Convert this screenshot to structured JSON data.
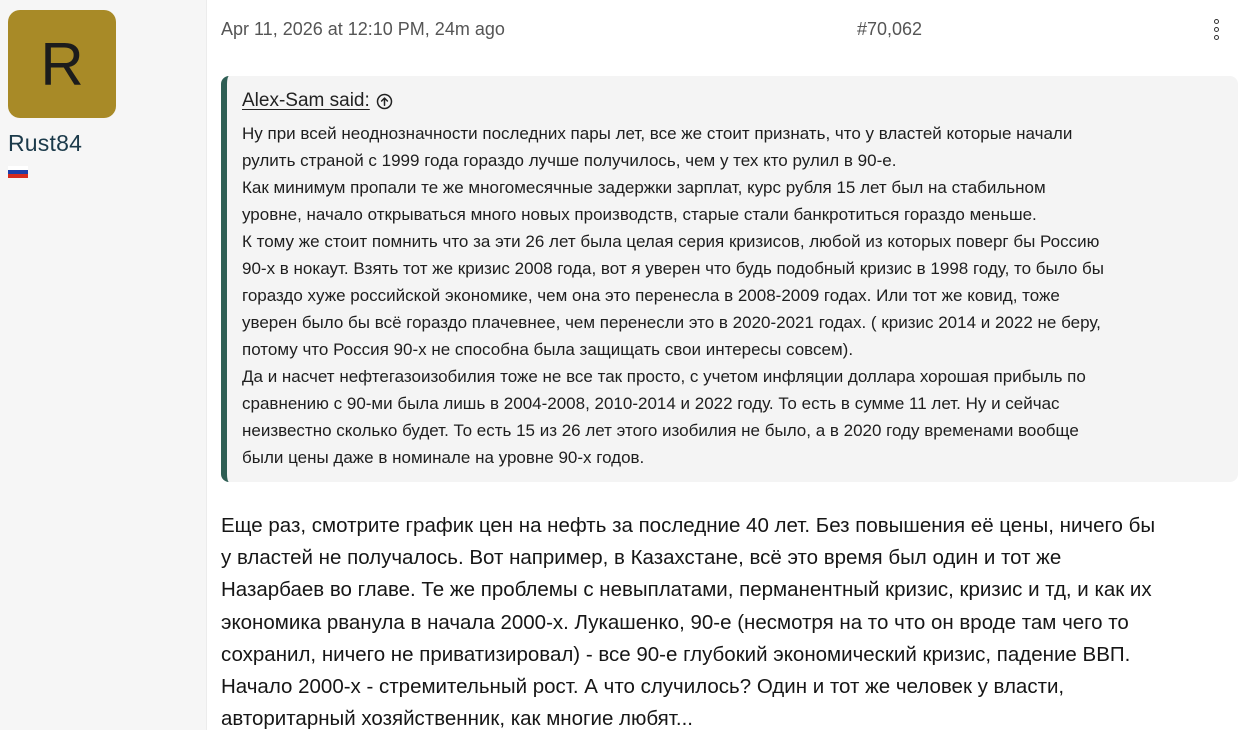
{
  "user": {
    "avatar_letter": "R",
    "avatar_color": "#a88a27",
    "name": "Rust84",
    "flag_icon": "russia-flag-icon",
    "flag_colors": [
      "#ffffff",
      "#1c3fa8",
      "#d52b1e"
    ]
  },
  "post": {
    "date": "Apr 11, 2026 at 12:10 PM, 24m ago",
    "number": "#70,062",
    "menu_icon": "vertical-ellipsis-icon"
  },
  "quote": {
    "author_said": "Alex-Sam said:",
    "jump_icon": "arrow-up-circle-icon",
    "accent_color": "#2e5e54",
    "lines": [
      "Ну при всей неоднозначности последних пары лет, все же стоит признать, что у властей которые начали",
      "рулить страной с 1999 года гораздо лучше получилось, чем у тех кто рулил в 90-е.",
      "Как минимум пропали те же многомесячные задержки зарплат, курс рубля 15 лет был на стабильном",
      "уровне, начало открываться много новых производств, старые стали банкротиться гораздо меньше.",
      "К тому же стоит помнить что за эти 26 лет была целая серия кризисов, любой из которых поверг бы Россию",
      "90-х в нокаут. Взять тот же кризис 2008 года, вот я уверен что будь подобный кризис в 1998 году, то было бы",
      "гораздо хуже российской экономике, чем она это перенесла в 2008-2009 годах. Или тот же ковид, тоже",
      "уверен было бы всё гораздо плачевнее, чем перенесли это в 2020-2021 годах. ( кризис 2014 и 2022 не беру,",
      "потому что Россия 90-х не способна была защищать свои интересы совсем).",
      "Да и насчет нефтегазоизобилия тоже не все так просто, с учетом инфляции доллара хорошая прибыль по",
      "сравнению с 90-ми была лишь в 2004-2008, 2010-2014 и 2022 году. То есть в сумме 11 лет. Ну и сейчас",
      "неизвестно сколько будет. То есть 15 из 26 лет этого изобилия не было, а в 2020 году временами вообще",
      "были цены даже в номинале на уровне 90-х годов."
    ]
  },
  "message": {
    "lines": [
      "Еще раз, смотрите график цен на нефть за последние 40 лет. Без повышения её цены, ничего бы",
      "у властей не получалось. Вот например, в Казахстане, всё это время был один и тот же",
      "Назарбаев во главе. Те же проблемы с невыплатами, перманентный кризис, кризис и тд, и как их",
      "экономика рванула в начала 2000-х. Лукашенко, 90-е (несмотря на то что он вроде там чего то",
      "сохранил, ничего не приватизировал) - все 90-е глубокий экономический кризис, падение ВВП.",
      "Начало 2000-х - стремительный рост. А что случилось? Один и тот же человек у власти,",
      "авторитарный хозяйственник, как многие любят..."
    ]
  }
}
